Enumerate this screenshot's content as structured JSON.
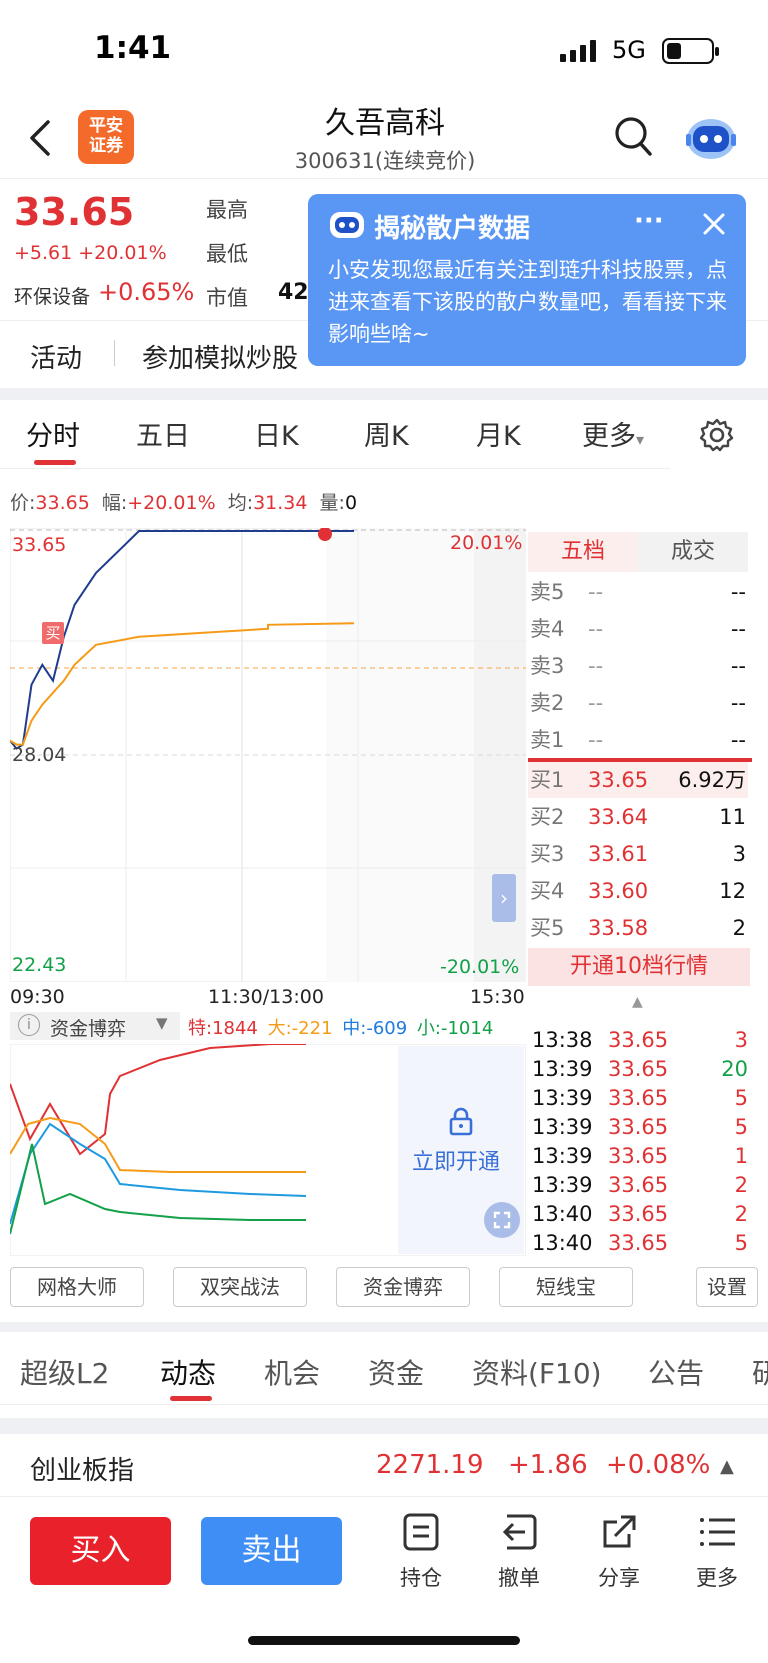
{
  "status": {
    "time": "1:41",
    "network": "5G"
  },
  "header": {
    "back_icon": "chevron-left-icon",
    "logo_text_1": "平安",
    "logo_text_2": "证券",
    "stock_name": "久吾高科",
    "stock_code": "300631(连续竞价)",
    "search_icon": "search-icon",
    "assistant_icon": "robot-avatar-icon"
  },
  "quote": {
    "price": "33.65",
    "change": "+5.61 +20.01%",
    "sector_name": "环保设备",
    "sector_change": "+0.65%",
    "high_label": "最高",
    "low_label": "最低",
    "cap_label": "市值",
    "cap_value": "42"
  },
  "popup": {
    "title": "揭秘散户数据",
    "more": "···",
    "body": "小安发现您最近有关注到琏升科技股票，点进来查看下该股的散户数量吧，看看接下来影响些啥~"
  },
  "activity": {
    "label": "活动",
    "text": "参加模拟炒股"
  },
  "chart_tabs": [
    "分时",
    "五日",
    "日K",
    "周K",
    "月K",
    "更多"
  ],
  "info_line": {
    "price_label": "价:",
    "price": "33.65",
    "amp_label": "幅:",
    "amp": "+20.01%",
    "avg_label": "均:",
    "avg": "31.34",
    "vol_label": "量:",
    "vol": "0"
  },
  "chart_labels": {
    "y_top": "33.65",
    "y_mid": "28.04",
    "y_bottom": "22.43",
    "pct_top": "20.01%",
    "pct_bottom": "-20.01%",
    "x_start": "09:30",
    "x_mid": "11:30/13:00",
    "x_end": "15:30",
    "buy_marker": "买"
  },
  "chart_data": [
    {
      "type": "line",
      "x": [
        "09:30",
        "09:33",
        "09:36",
        "09:40",
        "09:45",
        "09:50",
        "09:55",
        "10:00",
        "10:10",
        "10:30",
        "11:00",
        "11:30",
        "13:00",
        "13:40"
      ],
      "series": [
        {
          "values": [
            28.4,
            28.2,
            28.3,
            29.8,
            30.3,
            29.9,
            31.0,
            31.8,
            32.6,
            33.65,
            33.65,
            33.65,
            33.65,
            33.65
          ]
        },
        {
          "values": [
            28.4,
            28.3,
            28.3,
            28.9,
            29.3,
            29.6,
            29.9,
            30.3,
            30.8,
            31.0,
            31.1,
            31.2,
            31.3,
            31.34
          ]
        }
      ],
      "ylim": [
        22.43,
        33.65
      ]
    },
    {
      "type": "line",
      "title": "资金博弈",
      "series": [
        {
          "name": "特",
          "last": 1844
        },
        {
          "name": "大",
          "last": -221
        },
        {
          "name": "中",
          "last": -609
        },
        {
          "name": "小",
          "last": -1014
        }
      ]
    }
  ],
  "fund_game": {
    "title": "资金博弈",
    "te": "特:1844",
    "da": "大:-221",
    "zhong": "中:-609",
    "xiao": "小:-1014",
    "unlock": "立即开通"
  },
  "order_book": {
    "tab_five": "五档",
    "tab_deal": "成交",
    "asks": [
      {
        "label": "卖5",
        "price": "--",
        "vol": "--"
      },
      {
        "label": "卖4",
        "price": "--",
        "vol": "--"
      },
      {
        "label": "卖3",
        "price": "--",
        "vol": "--"
      },
      {
        "label": "卖2",
        "price": "--",
        "vol": "--"
      },
      {
        "label": "卖1",
        "price": "--",
        "vol": "--"
      }
    ],
    "bids": [
      {
        "label": "买1",
        "price": "33.65",
        "vol": "6.92万"
      },
      {
        "label": "买2",
        "price": "33.64",
        "vol": "11"
      },
      {
        "label": "买3",
        "price": "33.61",
        "vol": "3"
      },
      {
        "label": "买4",
        "price": "33.60",
        "vol": "12"
      },
      {
        "label": "买5",
        "price": "33.58",
        "vol": "2"
      }
    ],
    "open10": "开通10档行情"
  },
  "trades": [
    {
      "time": "13:38",
      "price": "33.65",
      "vol": "3"
    },
    {
      "time": "13:39",
      "price": "33.65",
      "vol": "20"
    },
    {
      "time": "13:39",
      "price": "33.65",
      "vol": "5"
    },
    {
      "time": "13:39",
      "price": "33.65",
      "vol": "5"
    },
    {
      "time": "13:39",
      "price": "33.65",
      "vol": "1"
    },
    {
      "time": "13:39",
      "price": "33.65",
      "vol": "2"
    },
    {
      "time": "13:40",
      "price": "33.65",
      "vol": "2"
    },
    {
      "time": "13:40",
      "price": "33.65",
      "vol": "5"
    }
  ],
  "tools": [
    "网格大师",
    "双突战法",
    "资金博弈",
    "短线宝",
    "设置"
  ],
  "bottom_tabs": [
    "超级L2",
    "动态",
    "机会",
    "资金",
    "资料(F10)",
    "公告",
    "研"
  ],
  "index_row": {
    "name": "创业板指",
    "value": "2271.19",
    "change": "+1.86",
    "pct": "+0.08%"
  },
  "actions": {
    "buy": "买入",
    "sell": "卖出",
    "position": "持仓",
    "cancel": "撤单",
    "share": "分享",
    "more": "更多"
  }
}
